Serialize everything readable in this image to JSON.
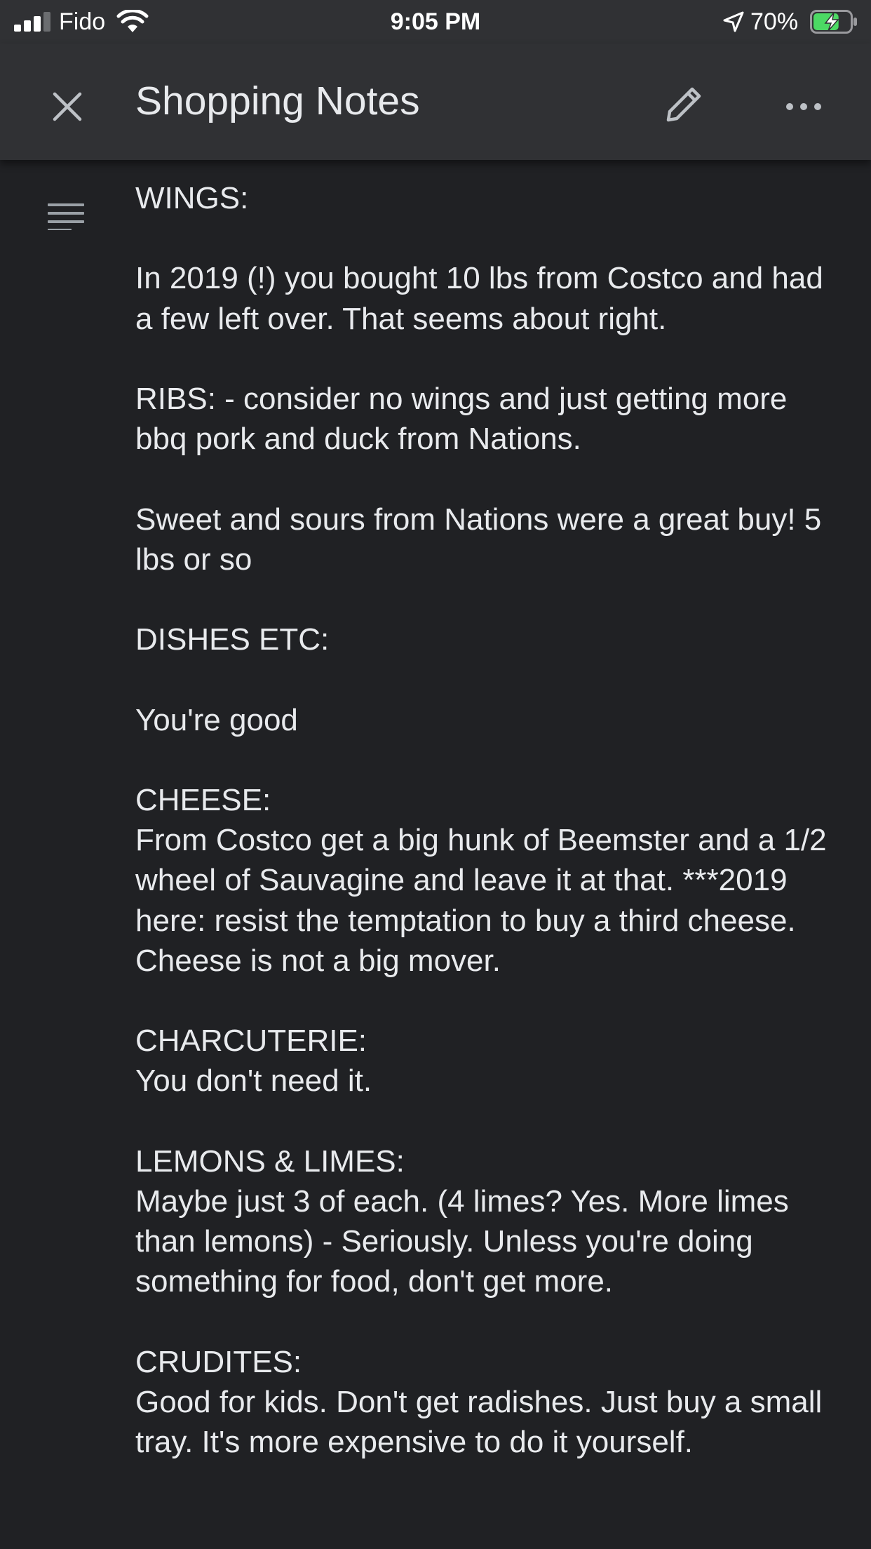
{
  "status_bar": {
    "carrier": "Fido",
    "time": "9:05 PM",
    "battery_percent": "70%",
    "battery_level": 0.7,
    "charging": true,
    "signal_bars": 3,
    "signal_bars_total": 4,
    "icons": [
      "signal-icon",
      "wifi-icon",
      "location-arrow-icon",
      "battery-charging-icon"
    ],
    "colors": {
      "battery_fill": "#4cd964"
    }
  },
  "app_bar": {
    "title": "Shopping Notes",
    "icons": [
      "close-icon",
      "pencil-icon",
      "more-horizontal-icon"
    ]
  },
  "content": {
    "outline_icon": "outline-list-icon",
    "text": "WINGS:\n\nIn 2019 (!) you bought 10 lbs from Costco and had a few left over. That seems about right.\n\nRIBS: - consider no wings and just getting more bbq pork and duck from Nations.\n\nSweet and sours from Nations were a great buy! 5 lbs or so\n\nDISHES ETC:\n\nYou're good\n\nCHEESE:\nFrom Costco get a big hunk of Beemster and a 1/2 wheel of Sauvagine and leave it at that. ***2019 here: resist the temptation to buy a third cheese. Cheese is not a big mover.\n\nCHARCUTERIE:\nYou don't need it.\n\nLEMONS & LIMES:\nMaybe just 3 of each. (4 limes? Yes. More limes than lemons) - Seriously. Unless you're doing something for food, don't get more.\n\nCRUDITES:\nGood for kids. Don't get radishes. Just buy a small tray. It's more expensive to do it yourself."
  },
  "colors": {
    "background": "#202124",
    "bar": "#303134",
    "text": "#e8eaed",
    "icon": "#bdc1c6"
  }
}
